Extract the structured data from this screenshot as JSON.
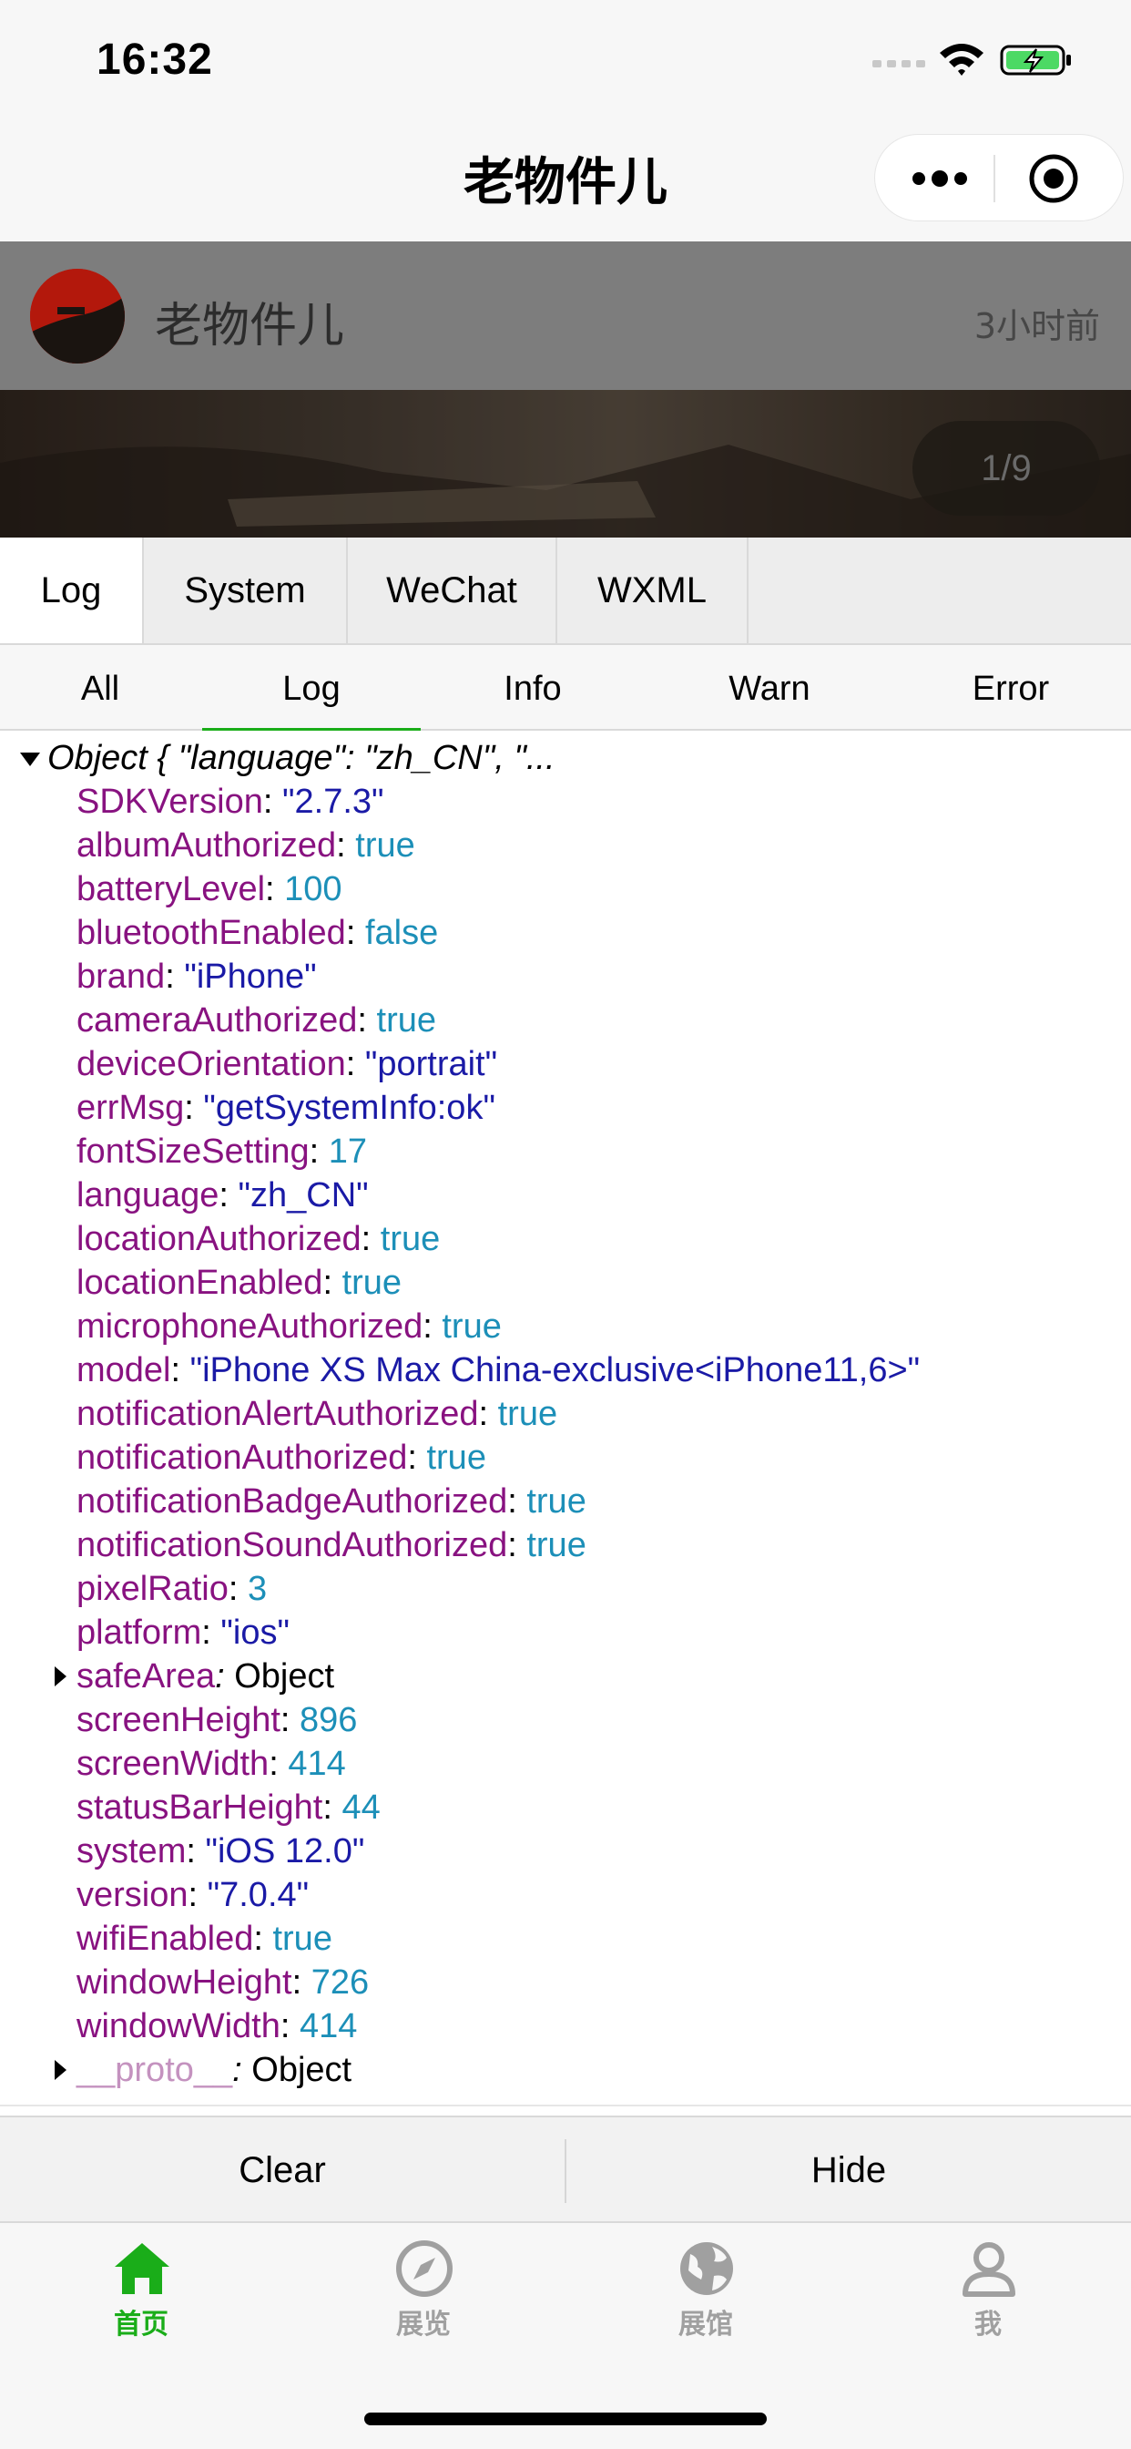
{
  "status_bar": {
    "time": "16:32"
  },
  "nav": {
    "title": "老物件儿"
  },
  "post": {
    "author": "老物件儿",
    "time": "3小时前",
    "image_counter": "1/9"
  },
  "vconsole": {
    "tabs": [
      {
        "label": "Log",
        "active": true
      },
      {
        "label": "System"
      },
      {
        "label": "WeChat"
      },
      {
        "label": "WXML"
      }
    ],
    "subtabs": [
      {
        "label": "All"
      },
      {
        "label": "Log",
        "active": true
      },
      {
        "label": "Info"
      },
      {
        "label": "Warn"
      },
      {
        "label": "Error"
      }
    ],
    "object_header": "Object { \"language\": \"zh_CN\", \"...",
    "entries": [
      {
        "key": "SDKVersion",
        "value": "\"2.7.3\"",
        "type": "string"
      },
      {
        "key": "albumAuthorized",
        "value": "true",
        "type": "bool"
      },
      {
        "key": "batteryLevel",
        "value": "100",
        "type": "number"
      },
      {
        "key": "bluetoothEnabled",
        "value": "false",
        "type": "bool"
      },
      {
        "key": "brand",
        "value": "\"iPhone\"",
        "type": "string"
      },
      {
        "key": "cameraAuthorized",
        "value": "true",
        "type": "bool"
      },
      {
        "key": "deviceOrientation",
        "value": "\"portrait\"",
        "type": "string"
      },
      {
        "key": "errMsg",
        "value": "\"getSystemInfo:ok\"",
        "type": "string"
      },
      {
        "key": "fontSizeSetting",
        "value": "17",
        "type": "number"
      },
      {
        "key": "language",
        "value": "\"zh_CN\"",
        "type": "string"
      },
      {
        "key": "locationAuthorized",
        "value": "true",
        "type": "bool"
      },
      {
        "key": "locationEnabled",
        "value": "true",
        "type": "bool"
      },
      {
        "key": "microphoneAuthorized",
        "value": "true",
        "type": "bool"
      },
      {
        "key": "model",
        "value": "\"iPhone XS Max China-exclusive<iPhone11,6>\"",
        "type": "string"
      },
      {
        "key": "notificationAlertAuthorized",
        "value": "true",
        "type": "bool"
      },
      {
        "key": "notificationAuthorized",
        "value": "true",
        "type": "bool"
      },
      {
        "key": "notificationBadgeAuthorized",
        "value": "true",
        "type": "bool"
      },
      {
        "key": "notificationSoundAuthorized",
        "value": "true",
        "type": "bool"
      },
      {
        "key": "pixelRatio",
        "value": "3",
        "type": "number"
      },
      {
        "key": "platform",
        "value": "\"ios\"",
        "type": "string"
      },
      {
        "key": "safeArea",
        "value": "Object",
        "type": "object"
      },
      {
        "key": "screenHeight",
        "value": "896",
        "type": "number"
      },
      {
        "key": "screenWidth",
        "value": "414",
        "type": "number"
      },
      {
        "key": "statusBarHeight",
        "value": "44",
        "type": "number"
      },
      {
        "key": "system",
        "value": "\"iOS 12.0\"",
        "type": "string"
      },
      {
        "key": "version",
        "value": "\"7.0.4\"",
        "type": "string"
      },
      {
        "key": "wifiEnabled",
        "value": "true",
        "type": "bool"
      },
      {
        "key": "windowHeight",
        "value": "726",
        "type": "number"
      },
      {
        "key": "windowWidth",
        "value": "414",
        "type": "number"
      },
      {
        "key": "__proto__",
        "value": "Object",
        "type": "proto"
      }
    ],
    "toolbar": {
      "clear_label": "Clear",
      "hide_label": "Hide"
    }
  },
  "tabbar": {
    "items": [
      {
        "label": "首页",
        "icon": "home-icon",
        "active": true
      },
      {
        "label": "展览",
        "icon": "compass-icon"
      },
      {
        "label": "展馆",
        "icon": "globe-icon"
      },
      {
        "label": "我",
        "icon": "user-icon"
      }
    ]
  },
  "colors": {
    "accent": "#1aad19",
    "json_key": "#881280",
    "json_string": "#1a1aa6",
    "json_number": "#1c8fb8"
  }
}
